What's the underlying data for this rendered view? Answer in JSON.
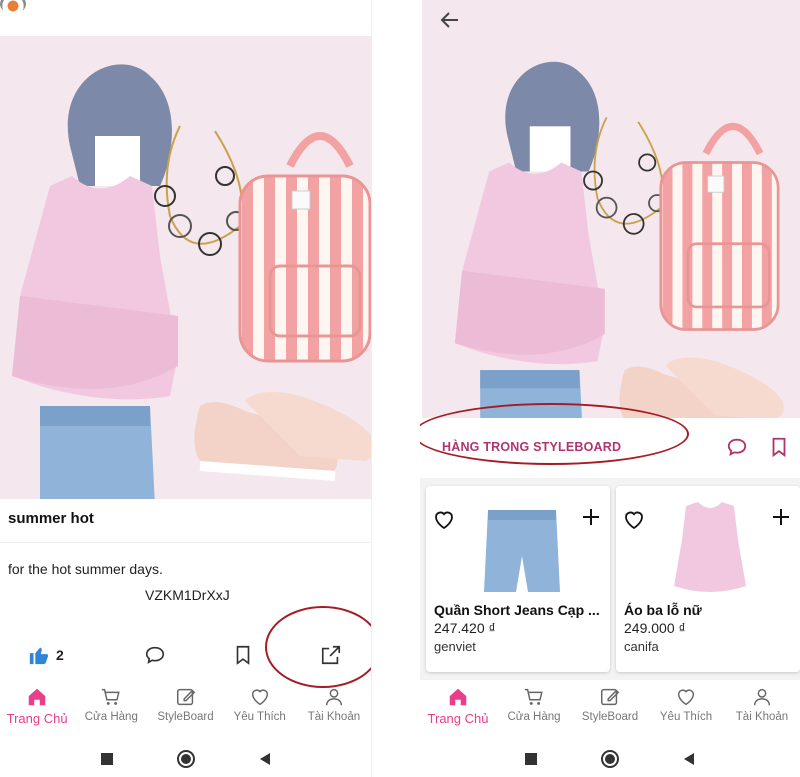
{
  "left": {
    "post_title": "summer hot",
    "post_description": "for the hot summer days.",
    "post_code": "VZKM1DrXxJ",
    "like_count": "2"
  },
  "right": {
    "section_title": "HÀNG TRONG STYLEBOARD",
    "products": [
      {
        "name": "Quần Short Jeans Cạp ...",
        "price": "247.420 ₫",
        "store": "genviet",
        "icon": "denim-shorts"
      },
      {
        "name": "Áo ba lỗ nữ",
        "price": "249.000 ₫",
        "store": "canifa",
        "icon": "pink-tank-top"
      }
    ]
  },
  "nav": [
    {
      "label": "Trang Chủ",
      "icon": "home-icon",
      "active": true
    },
    {
      "label": "Cửa Hàng",
      "icon": "cart-icon"
    },
    {
      "label": "StyleBoard",
      "icon": "edit-icon"
    },
    {
      "label": "Yêu Thích",
      "icon": "heart-icon"
    },
    {
      "label": "Tài Khoản",
      "icon": "user-icon"
    }
  ],
  "colors": {
    "accent": "#e83e8c",
    "section_title": "#b0356e",
    "annotation_ellipse": "#a51d24",
    "like_blue": "#2d86d9",
    "collage_bg": "#f4e7ed"
  }
}
